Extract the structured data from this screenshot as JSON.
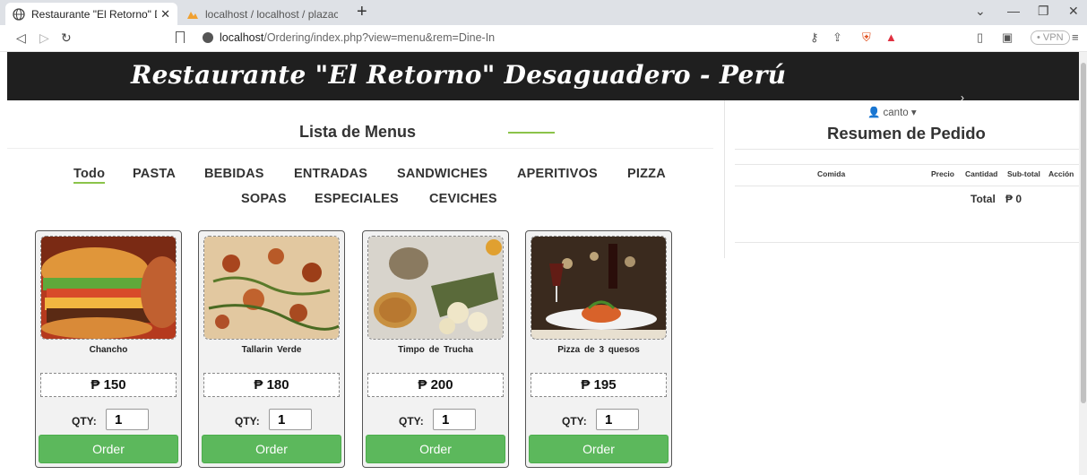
{
  "browser": {
    "tabs": [
      {
        "label": "Restaurante \"El Retorno\" Desagu",
        "active": true
      },
      {
        "label": "localhost / localhost / plazacafedb / ta",
        "active": false
      }
    ],
    "url_host": "localhost",
    "url_path": "/Ordering/index.php?view=menu&rem=Dine-In",
    "vpn_label": "• VPN"
  },
  "header": {
    "title": "Restaurante \"El Retorno\" Desaguadero - Perú"
  },
  "menu": {
    "title": "Lista de Menus",
    "categories": [
      "Todo",
      "PASTA",
      "BEBIDAS",
      "ENTRADAS",
      "SANDWICHES",
      "APERITIVOS",
      "PIZZA",
      "SOPAS",
      "ESPECIALES",
      "CEVICHES"
    ],
    "active_category": "Todo",
    "currency_symbol": "₱",
    "qty_label": "QTY:",
    "order_label": "Order",
    "items": [
      {
        "name": "Chancho",
        "price": "₱ 150",
        "qty": "1"
      },
      {
        "name": "Tallarin Verde",
        "price": "₱ 180",
        "qty": "1"
      },
      {
        "name": "Timpo de Trucha",
        "price": "₱ 200",
        "qty": "1"
      },
      {
        "name": "Pizza de 3 quesos",
        "price": "₱ 195",
        "qty": "1"
      }
    ]
  },
  "summary": {
    "user": "canto",
    "title": "Resumen de Pedido",
    "columns": [
      "Comida",
      "Precio",
      "Cantidad",
      "Sub-total",
      "Acción"
    ],
    "total_label": "Total",
    "total_value": "₱ 0"
  },
  "colors": {
    "accent_green": "#5cb85c",
    "banner_bg": "#1f1f1f",
    "underline": "#8bc34a"
  }
}
